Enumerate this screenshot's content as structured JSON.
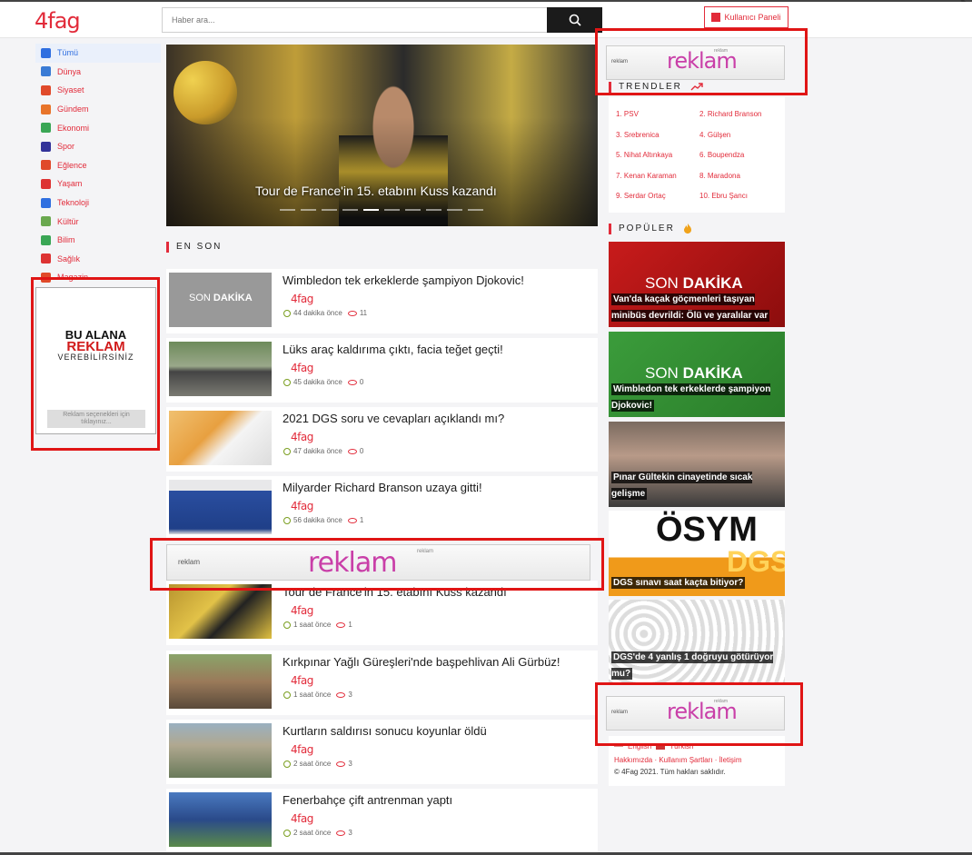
{
  "header": {
    "logo": "4fag",
    "search_placeholder": "Haber ara...",
    "user_panel_label": "Kullanıcı Paneli"
  },
  "sidebar": {
    "items": [
      {
        "label": "Tümü",
        "icon": "list-icon",
        "color": "#2f6fe0",
        "active": true
      },
      {
        "label": "Dünya",
        "icon": "world-icon",
        "color": "#3a7bd5"
      },
      {
        "label": "Siyaset",
        "icon": "building-icon",
        "color": "#e04a2a"
      },
      {
        "label": "Gündem",
        "icon": "person-icon",
        "color": "#e8742a"
      },
      {
        "label": "Ekonomi",
        "icon": "chart-icon",
        "color": "#3aa655"
      },
      {
        "label": "Spor",
        "icon": "ball-icon",
        "color": "#333399"
      },
      {
        "label": "Eğlence",
        "icon": "party-icon",
        "color": "#e04a2a"
      },
      {
        "label": "Yaşam",
        "icon": "glasses-icon",
        "color": "#d33"
      },
      {
        "label": "Teknoloji",
        "icon": "device-icon",
        "color": "#2f6fe0"
      },
      {
        "label": "Kültür",
        "icon": "book-icon",
        "color": "#6aa84f"
      },
      {
        "label": "Bilim",
        "icon": "atom-icon",
        "color": "#3aa655"
      },
      {
        "label": "Sağlık",
        "icon": "heartbeat-icon",
        "color": "#d33"
      },
      {
        "label": "Magazin",
        "icon": "star-icon",
        "color": "#e04a2a"
      }
    ]
  },
  "ads": {
    "left_line1": "BU ALANA",
    "left_line2": "REKLAM",
    "left_line3": "VEREBİLİRSİNİZ",
    "left_options": "Reklam seçenekleri için tıklayınız...",
    "banner_small": "reklam",
    "banner_big": "reklam",
    "banner_tiny": "reklam"
  },
  "hero": {
    "title": "Tour de France'in 15. etabını Kuss kazandı",
    "slide_count": 10,
    "active_slide": 5
  },
  "latest": {
    "heading": "EN SON",
    "items": [
      {
        "title": "Wimbledon tek erkeklerde şampiyon Djokovic!",
        "source": "4fag",
        "time": "44 dakika önce",
        "views": "11",
        "thumb": "sondakika",
        "thumb_text_a": "SON",
        "thumb_text_b": "DAKİKA"
      },
      {
        "title": "Lüks araç kaldırıma çıktı, facia teğet geçti!",
        "source": "4fag",
        "time": "45 dakika önce",
        "views": "0",
        "thumb": "car"
      },
      {
        "title": "2021 DGS soru ve cevapları açıklandı mı?",
        "source": "4fag",
        "time": "47 dakika önce",
        "views": "0",
        "thumb": "exam"
      },
      {
        "title": "Milyarder Richard Branson uzaya gitti!",
        "source": "4fag",
        "time": "56 dakika önce",
        "views": "1",
        "thumb": "space"
      },
      {
        "title": "Tour de France'in 15. etabını Kuss kazandı",
        "source": "4fag",
        "time": "1 saat önce",
        "views": "1",
        "thumb": "cycling"
      },
      {
        "title": "Kırkpınar Yağlı Güreşleri'nde başpehlivan Ali Gürbüz!",
        "source": "4fag",
        "time": "1 saat önce",
        "views": "3",
        "thumb": "wrestling"
      },
      {
        "title": "Kurtların saldırısı sonucu koyunlar öldü",
        "source": "4fag",
        "time": "2 saat önce",
        "views": "3",
        "thumb": "sheep"
      },
      {
        "title": "Fenerbahçe çift antrenman yaptı",
        "source": "4fag",
        "time": "2 saat önce",
        "views": "3",
        "thumb": "football"
      }
    ]
  },
  "trends": {
    "heading": "TRENDLER",
    "items": [
      "1. PSV",
      "2. Richard Branson",
      "3. Srebrenica",
      "4. Gülşen",
      "5. Nihat Altınkaya",
      "6. Boupendza",
      "7. Kenan Karaman",
      "8. Maradona",
      "9. Serdar Ortaç",
      "10. Ebru Şancı"
    ]
  },
  "popular": {
    "heading": "POPÜLER",
    "items": [
      {
        "caption": "Van'da kaçak göçmenleri taşıyan minibüs devrildi: Ölü ve yaralılar var",
        "thumb_text_a": "SON",
        "thumb_text_b": "DAKİKA"
      },
      {
        "caption": "Wimbledon tek erkeklerde şampiyon Djokovic!",
        "thumb_text_a": "SON",
        "thumb_text_b": "DAKİKA"
      },
      {
        "caption": "Pınar Gültekin cinayetinde sıcak gelişme"
      },
      {
        "caption": "DGS sınavı saat kaçta bitiyor?",
        "thumb_text_a": "ÖSYM",
        "thumb_text_b": "DGS"
      },
      {
        "caption": "DGS'de 4 yanlış 1 doğruyu götürüyor mu?"
      }
    ]
  },
  "footer": {
    "lang_en": "English",
    "lang_tr": "Türkish",
    "links": "Hakkımızda · Kullanım Şartları · İletişim",
    "copyright": "© 4Fag 2021. Tüm hakları saklıdır."
  }
}
